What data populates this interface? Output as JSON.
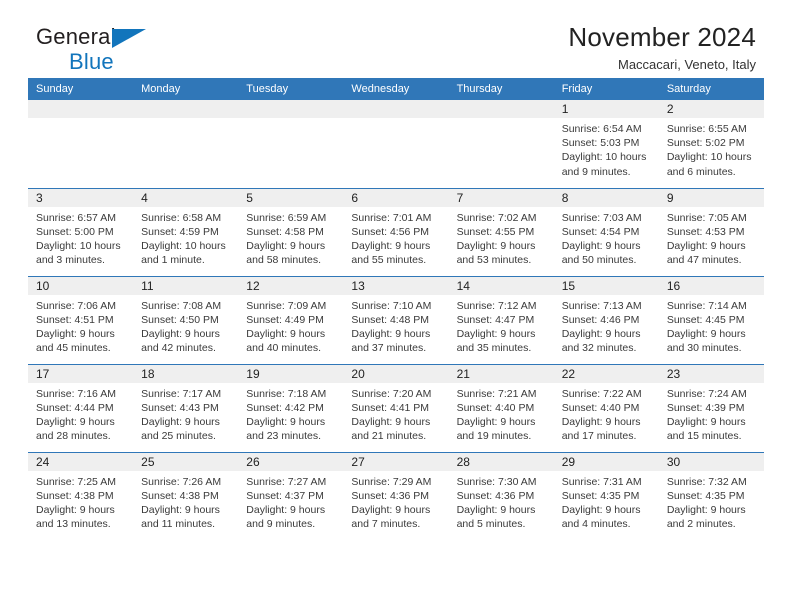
{
  "brand": {
    "line1": "General",
    "line2": "Blue",
    "accent_color": "#1275bc"
  },
  "header": {
    "title": "November 2024",
    "subtitle": "Maccacari, Veneto, Italy"
  },
  "theme": {
    "header_blue": "#3077b8",
    "daynum_bg": "#efefef",
    "text": "#222222"
  },
  "calendar": {
    "weekday_headers": [
      "Sunday",
      "Monday",
      "Tuesday",
      "Wednesday",
      "Thursday",
      "Friday",
      "Saturday"
    ],
    "weeks": [
      [
        {
          "day": "",
          "empty": true
        },
        {
          "day": "",
          "empty": true
        },
        {
          "day": "",
          "empty": true
        },
        {
          "day": "",
          "empty": true
        },
        {
          "day": "",
          "empty": true
        },
        {
          "day": "1",
          "sunrise": "Sunrise: 6:54 AM",
          "sunset": "Sunset: 5:03 PM",
          "daylight": "Daylight: 10 hours and 9 minutes."
        },
        {
          "day": "2",
          "sunrise": "Sunrise: 6:55 AM",
          "sunset": "Sunset: 5:02 PM",
          "daylight": "Daylight: 10 hours and 6 minutes."
        }
      ],
      [
        {
          "day": "3",
          "sunrise": "Sunrise: 6:57 AM",
          "sunset": "Sunset: 5:00 PM",
          "daylight": "Daylight: 10 hours and 3 minutes."
        },
        {
          "day": "4",
          "sunrise": "Sunrise: 6:58 AM",
          "sunset": "Sunset: 4:59 PM",
          "daylight": "Daylight: 10 hours and 1 minute."
        },
        {
          "day": "5",
          "sunrise": "Sunrise: 6:59 AM",
          "sunset": "Sunset: 4:58 PM",
          "daylight": "Daylight: 9 hours and 58 minutes."
        },
        {
          "day": "6",
          "sunrise": "Sunrise: 7:01 AM",
          "sunset": "Sunset: 4:56 PM",
          "daylight": "Daylight: 9 hours and 55 minutes."
        },
        {
          "day": "7",
          "sunrise": "Sunrise: 7:02 AM",
          "sunset": "Sunset: 4:55 PM",
          "daylight": "Daylight: 9 hours and 53 minutes."
        },
        {
          "day": "8",
          "sunrise": "Sunrise: 7:03 AM",
          "sunset": "Sunset: 4:54 PM",
          "daylight": "Daylight: 9 hours and 50 minutes."
        },
        {
          "day": "9",
          "sunrise": "Sunrise: 7:05 AM",
          "sunset": "Sunset: 4:53 PM",
          "daylight": "Daylight: 9 hours and 47 minutes."
        }
      ],
      [
        {
          "day": "10",
          "sunrise": "Sunrise: 7:06 AM",
          "sunset": "Sunset: 4:51 PM",
          "daylight": "Daylight: 9 hours and 45 minutes."
        },
        {
          "day": "11",
          "sunrise": "Sunrise: 7:08 AM",
          "sunset": "Sunset: 4:50 PM",
          "daylight": "Daylight: 9 hours and 42 minutes."
        },
        {
          "day": "12",
          "sunrise": "Sunrise: 7:09 AM",
          "sunset": "Sunset: 4:49 PM",
          "daylight": "Daylight: 9 hours and 40 minutes."
        },
        {
          "day": "13",
          "sunrise": "Sunrise: 7:10 AM",
          "sunset": "Sunset: 4:48 PM",
          "daylight": "Daylight: 9 hours and 37 minutes."
        },
        {
          "day": "14",
          "sunrise": "Sunrise: 7:12 AM",
          "sunset": "Sunset: 4:47 PM",
          "daylight": "Daylight: 9 hours and 35 minutes."
        },
        {
          "day": "15",
          "sunrise": "Sunrise: 7:13 AM",
          "sunset": "Sunset: 4:46 PM",
          "daylight": "Daylight: 9 hours and 32 minutes."
        },
        {
          "day": "16",
          "sunrise": "Sunrise: 7:14 AM",
          "sunset": "Sunset: 4:45 PM",
          "daylight": "Daylight: 9 hours and 30 minutes."
        }
      ],
      [
        {
          "day": "17",
          "sunrise": "Sunrise: 7:16 AM",
          "sunset": "Sunset: 4:44 PM",
          "daylight": "Daylight: 9 hours and 28 minutes."
        },
        {
          "day": "18",
          "sunrise": "Sunrise: 7:17 AM",
          "sunset": "Sunset: 4:43 PM",
          "daylight": "Daylight: 9 hours and 25 minutes."
        },
        {
          "day": "19",
          "sunrise": "Sunrise: 7:18 AM",
          "sunset": "Sunset: 4:42 PM",
          "daylight": "Daylight: 9 hours and 23 minutes."
        },
        {
          "day": "20",
          "sunrise": "Sunrise: 7:20 AM",
          "sunset": "Sunset: 4:41 PM",
          "daylight": "Daylight: 9 hours and 21 minutes."
        },
        {
          "day": "21",
          "sunrise": "Sunrise: 7:21 AM",
          "sunset": "Sunset: 4:40 PM",
          "daylight": "Daylight: 9 hours and 19 minutes."
        },
        {
          "day": "22",
          "sunrise": "Sunrise: 7:22 AM",
          "sunset": "Sunset: 4:40 PM",
          "daylight": "Daylight: 9 hours and 17 minutes."
        },
        {
          "day": "23",
          "sunrise": "Sunrise: 7:24 AM",
          "sunset": "Sunset: 4:39 PM",
          "daylight": "Daylight: 9 hours and 15 minutes."
        }
      ],
      [
        {
          "day": "24",
          "sunrise": "Sunrise: 7:25 AM",
          "sunset": "Sunset: 4:38 PM",
          "daylight": "Daylight: 9 hours and 13 minutes."
        },
        {
          "day": "25",
          "sunrise": "Sunrise: 7:26 AM",
          "sunset": "Sunset: 4:38 PM",
          "daylight": "Daylight: 9 hours and 11 minutes."
        },
        {
          "day": "26",
          "sunrise": "Sunrise: 7:27 AM",
          "sunset": "Sunset: 4:37 PM",
          "daylight": "Daylight: 9 hours and 9 minutes."
        },
        {
          "day": "27",
          "sunrise": "Sunrise: 7:29 AM",
          "sunset": "Sunset: 4:36 PM",
          "daylight": "Daylight: 9 hours and 7 minutes."
        },
        {
          "day": "28",
          "sunrise": "Sunrise: 7:30 AM",
          "sunset": "Sunset: 4:36 PM",
          "daylight": "Daylight: 9 hours and 5 minutes."
        },
        {
          "day": "29",
          "sunrise": "Sunrise: 7:31 AM",
          "sunset": "Sunset: 4:35 PM",
          "daylight": "Daylight: 9 hours and 4 minutes."
        },
        {
          "day": "30",
          "sunrise": "Sunrise: 7:32 AM",
          "sunset": "Sunset: 4:35 PM",
          "daylight": "Daylight: 9 hours and 2 minutes."
        }
      ]
    ]
  }
}
